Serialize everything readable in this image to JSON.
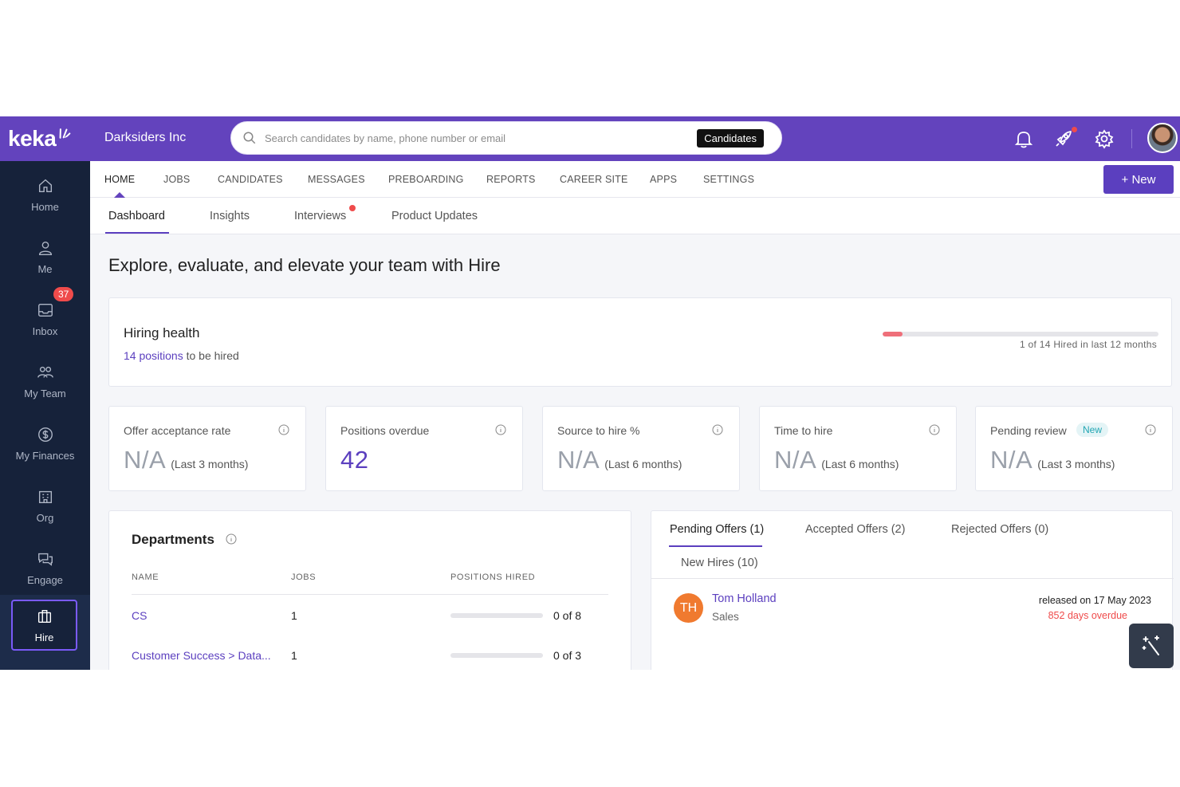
{
  "brand": {
    "logo_text": "keka"
  },
  "sidebar": {
    "items": [
      {
        "label": "Home",
        "icon": "home-icon"
      },
      {
        "label": "Me",
        "icon": "user-icon"
      },
      {
        "label": "Inbox",
        "icon": "inbox-icon",
        "badge": "37"
      },
      {
        "label": "My Team",
        "icon": "team-icon"
      },
      {
        "label": "My Finances",
        "icon": "dollar-icon"
      },
      {
        "label": "Org",
        "icon": "building-icon"
      },
      {
        "label": "Engage",
        "icon": "chat-icon"
      },
      {
        "label": "Hire",
        "icon": "briefcase-icon",
        "active": true
      }
    ]
  },
  "topbar": {
    "org_name": "Darksiders Inc",
    "search_placeholder": "Search candidates by name, phone number or email",
    "search_scope": "Candidates"
  },
  "main_nav": {
    "items": [
      "HOME",
      "JOBS",
      "CANDIDATES",
      "MESSAGES",
      "PREBOARDING",
      "REPORTS",
      "CAREER SITE",
      "APPS",
      "SETTINGS"
    ],
    "active": "HOME",
    "new_button": "+ New"
  },
  "sub_tabs": {
    "items": [
      "Dashboard",
      "Insights",
      "Interviews",
      "Product Updates"
    ],
    "active": "Dashboard"
  },
  "page": {
    "title": "Explore, evaluate, and elevate your team with Hire"
  },
  "hiring_health": {
    "title": "Hiring health",
    "positions_link": "14 positions",
    "positions_suffix": "to be hired",
    "hired": 1,
    "total": 14,
    "progress_label": "1 of 14 Hired in last 12 months"
  },
  "metrics": [
    {
      "label": "Offer acceptance rate",
      "value": "N/A",
      "period": "(Last 3 months)"
    },
    {
      "label": "Positions overdue",
      "value": "42",
      "period": ""
    },
    {
      "label": "Source to hire %",
      "value": "N/A",
      "period": "(Last 6 months)"
    },
    {
      "label": "Time to hire",
      "value": "N/A",
      "period": "(Last 6 months)"
    },
    {
      "label": "Pending review",
      "pill": "New",
      "value": "N/A",
      "period": "(Last 3 months)"
    }
  ],
  "departments": {
    "title": "Departments",
    "columns": [
      "NAME",
      "JOBS",
      "POSITIONS HIRED"
    ],
    "rows": [
      {
        "name": "CS",
        "jobs": "1",
        "hired": 0,
        "total": 8,
        "hired_label": "0 of 8"
      },
      {
        "name": "Customer Success > Data...",
        "jobs": "1",
        "hired": 0,
        "total": 3,
        "hired_label": "0 of 3"
      }
    ]
  },
  "offers": {
    "tabs": [
      "Pending Offers (1)",
      "Accepted Offers (2)",
      "Rejected Offers (0)",
      "New Hires (10)"
    ],
    "active": "Pending Offers (1)",
    "candidates": [
      {
        "initials": "TH",
        "name": "Tom Holland",
        "department": "Sales",
        "released": "released on 17 May 2023",
        "overdue": "852 days overdue"
      }
    ]
  },
  "colors": {
    "brand": "#6343bd",
    "sidebar": "#16223a",
    "accent": "#5b3fbf",
    "danger": "#ef4b4b",
    "avatar_orange": "#f07a2f"
  }
}
